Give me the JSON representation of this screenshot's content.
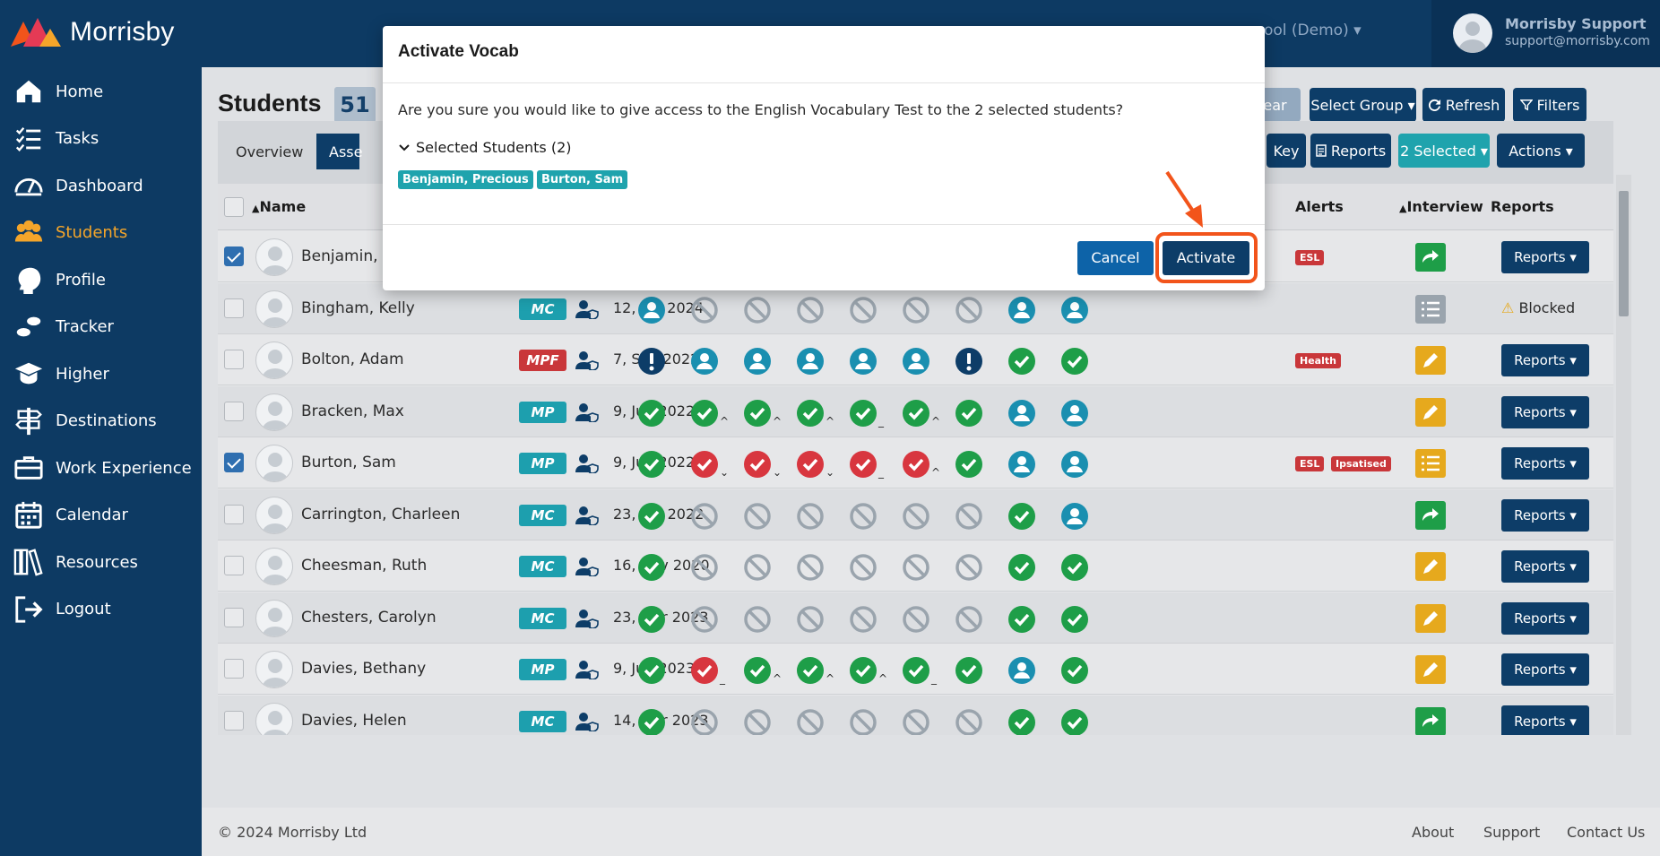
{
  "brand": {
    "name": "Morrisby"
  },
  "nav": [
    {
      "label": "Home",
      "icon": "home-icon"
    },
    {
      "label": "Tasks",
      "icon": "tasks-icon"
    },
    {
      "label": "Dashboard",
      "icon": "dashboard-icon"
    },
    {
      "label": "Students",
      "icon": "students-icon",
      "active": true
    },
    {
      "label": "Profile",
      "icon": "profile-head-icon"
    },
    {
      "label": "Tracker",
      "icon": "tracker-footsteps-icon"
    },
    {
      "label": "Higher",
      "icon": "graduation-icon"
    },
    {
      "label": "Destinations",
      "icon": "signpost-icon"
    },
    {
      "label": "Work Experience",
      "icon": "briefcase-icon"
    },
    {
      "label": "Calendar",
      "icon": "calendar-icon"
    },
    {
      "label": "Resources",
      "icon": "books-icon"
    },
    {
      "label": "Logout",
      "icon": "logout-icon"
    }
  ],
  "topbar": {
    "school": "ool (Demo) ▾",
    "user_name": "Morrisby Support",
    "user_email": "support@morrisby.com"
  },
  "page": {
    "title": "Students",
    "count": "51",
    "buttons": {
      "clear": "ear",
      "select_group": "Select Group ▾",
      "refresh": "Refresh",
      "filters": "Filters",
      "key": "Key",
      "reports": "Reports",
      "selected": "2 Selected ▾",
      "actions": "Actions ▾"
    },
    "tabs": [
      "Overview",
      "Asse"
    ]
  },
  "table": {
    "headers": {
      "name": "Name",
      "alerts": "Alerts",
      "interview": "Interview",
      "reports": "Reports"
    },
    "rows": [
      {
        "name": "Benjamin, P",
        "checked": true,
        "type": "",
        "date": "",
        "statuses": [
          "g",
          "g",
          "g",
          "g",
          "g",
          "y",
          "g",
          "g",
          "g"
        ],
        "marks": [
          "",
          "x",
          "x",
          "_",
          "x",
          "v",
          "",
          "",
          ""
        ],
        "alerts": [
          "ESL"
        ],
        "interview": "green-share",
        "report": "button"
      },
      {
        "name": "Bingham, Kelly",
        "checked": false,
        "type": "MC",
        "date": "12, Jan 2024",
        "statuses": [
          "p",
          "n",
          "n",
          "n",
          "n",
          "n",
          "n",
          "p",
          "p"
        ],
        "marks": [
          "",
          "",
          "",
          "",
          "",
          "",
          "",
          "",
          ""
        ],
        "alerts": [],
        "interview": "grey-list",
        "report": "blocked"
      },
      {
        "name": "Bolton, Adam",
        "checked": false,
        "type": "MPF",
        "date": "7, Sep 2022",
        "statuses": [
          "e",
          "p",
          "p",
          "p",
          "p",
          "p",
          "e",
          "g",
          "g"
        ],
        "marks": [
          "",
          "",
          "",
          "",
          "",
          "",
          "",
          "",
          ""
        ],
        "alerts": [
          "Health"
        ],
        "interview": "yellow-pencil",
        "report": "button"
      },
      {
        "name": "Bracken, Max",
        "checked": false,
        "type": "MP",
        "date": "9, Jun 2022",
        "statuses": [
          "g",
          "g",
          "g",
          "g",
          "g",
          "g",
          "g",
          "p",
          "p"
        ],
        "marks": [
          "",
          "^",
          "^",
          "^",
          "_",
          "^",
          "",
          "",
          ""
        ],
        "alerts": [],
        "interview": "yellow-pencil",
        "report": "button"
      },
      {
        "name": "Burton, Sam",
        "checked": true,
        "type": "MP",
        "date": "9, Jun 2022",
        "statuses": [
          "g",
          "r",
          "r",
          "r",
          "r",
          "r",
          "g",
          "p",
          "p"
        ],
        "marks": [
          "",
          "v",
          "v",
          "v",
          "_",
          "^",
          "",
          "",
          ""
        ],
        "alerts": [
          "ESL",
          "Ipsatised"
        ],
        "interview": "yellow-list",
        "report": "button"
      },
      {
        "name": "Carrington, Charleen",
        "checked": false,
        "type": "MC",
        "date": "23, Jun 2022",
        "statuses": [
          "g",
          "n",
          "n",
          "n",
          "n",
          "n",
          "n",
          "g",
          "p"
        ],
        "marks": [
          "",
          "",
          "",
          "",
          "",
          "",
          "",
          "",
          ""
        ],
        "alerts": [],
        "interview": "green-share",
        "report": "button"
      },
      {
        "name": "Cheesman, Ruth",
        "checked": false,
        "type": "MC",
        "date": "16, Nov 2020",
        "statuses": [
          "g",
          "n",
          "n",
          "n",
          "n",
          "n",
          "n",
          "g",
          "g"
        ],
        "marks": [
          "",
          "",
          "",
          "",
          "",
          "",
          "",
          "",
          ""
        ],
        "alerts": [],
        "interview": "yellow-pencil",
        "report": "button"
      },
      {
        "name": "Chesters, Carolyn",
        "checked": false,
        "type": "MC",
        "date": "23, Mar 2023",
        "statuses": [
          "g",
          "n",
          "n",
          "n",
          "n",
          "n",
          "n",
          "g",
          "g"
        ],
        "marks": [
          "",
          "",
          "",
          "",
          "",
          "",
          "",
          "",
          ""
        ],
        "alerts": [],
        "interview": "yellow-pencil",
        "report": "button"
      },
      {
        "name": "Davies, Bethany",
        "checked": false,
        "type": "MP",
        "date": "9, Jun 2023",
        "statuses": [
          "g",
          "r",
          "g",
          "g",
          "g",
          "g",
          "g",
          "p",
          "g"
        ],
        "marks": [
          "",
          "_",
          "^",
          "^",
          "^",
          "_",
          "",
          "",
          ""
        ],
        "alerts": [],
        "interview": "yellow-pencil",
        "report": "button"
      },
      {
        "name": "Davies, Helen",
        "checked": false,
        "type": "MC",
        "date": "14, Mar 2023",
        "statuses": [
          "g",
          "n",
          "n",
          "n",
          "n",
          "n",
          "n",
          "g",
          "g"
        ],
        "marks": [
          "",
          "",
          "",
          "",
          "",
          "",
          "",
          "",
          ""
        ],
        "alerts": [],
        "interview": "green-share",
        "report": "button"
      }
    ],
    "report_label": "Reports ▾",
    "blocked_label": "Blocked"
  },
  "footer": {
    "copyright": "© 2024 Morrisby Ltd",
    "links": [
      "About",
      "Support",
      "Contact Us"
    ]
  },
  "modal": {
    "title": "Activate Vocab",
    "message": "Are you sure you would like to give access to the English Vocabulary Test to the 2 selected students?",
    "selected_label": "Selected Students (2)",
    "chips": [
      "Benjamin, Precious",
      "Burton, Sam"
    ],
    "cancel": "Cancel",
    "activate": "Activate"
  },
  "colors": {
    "sidebar": "#0d3a63",
    "accent_orange": "#f2541b",
    "status_green": "#1e9e48",
    "status_red": "#d8363f",
    "status_teal": "#1a8fb0",
    "status_none": "#9aa4ad",
    "status_yellow": "#e6a91d",
    "status_navy": "#0d3d68"
  }
}
